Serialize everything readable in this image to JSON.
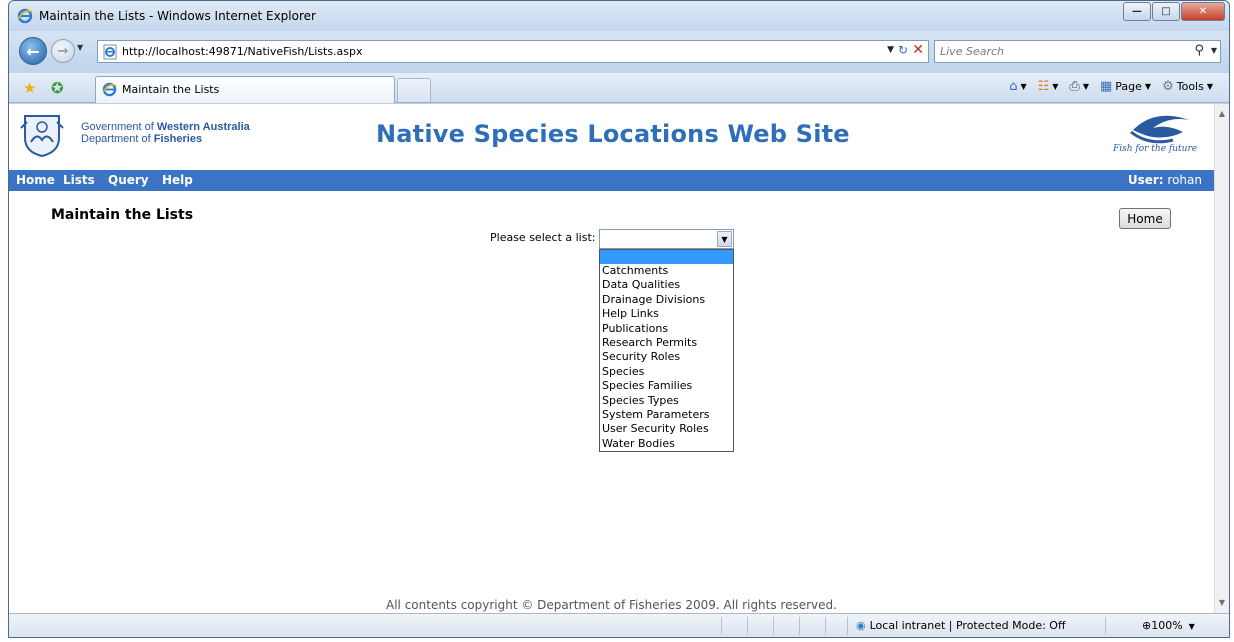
{
  "browser": {
    "window_title": "Maintain the Lists - Windows Internet Explorer",
    "url": "http://localhost:49871/NativeFish/Lists.aspx",
    "search_placeholder": "Live Search",
    "tab_title": "Maintain the Lists",
    "command_bar": {
      "page_label": "Page",
      "tools_label": "Tools"
    },
    "status_zone": "Local intranet | Protected Mode: Off",
    "zoom": "100%"
  },
  "header": {
    "gov_line1_prefix": "Government of ",
    "gov_line1_bold": "Western Australia",
    "gov_line2_prefix": "Department of ",
    "gov_line2_bold": "Fisheries",
    "site_title": "Native Species Locations Web Site",
    "tagline": "Fish for the future"
  },
  "menu": {
    "items": [
      "Home",
      "Lists",
      "Query",
      "Help"
    ],
    "user_label": "User:",
    "user_name": "rohan"
  },
  "page": {
    "heading": "Maintain the Lists",
    "home_button": "Home",
    "select_label": "Please select a list:",
    "select_value": "",
    "options": [
      "",
      "Catchments",
      "Data Qualities",
      "Drainage Divisions",
      "Help Links",
      "Publications",
      "Research Permits",
      "Security Roles",
      "Species",
      "Species Families",
      "Species Types",
      "System Parameters",
      "User Security Roles",
      "Water Bodies"
    ]
  },
  "footer": {
    "copyright": "All contents copyright © Department of Fisheries 2009. All rights reserved."
  },
  "colors": {
    "menu_bar": "#3b74c4",
    "site_title": "#2f6eb8",
    "selected_option": "#3399ff"
  }
}
